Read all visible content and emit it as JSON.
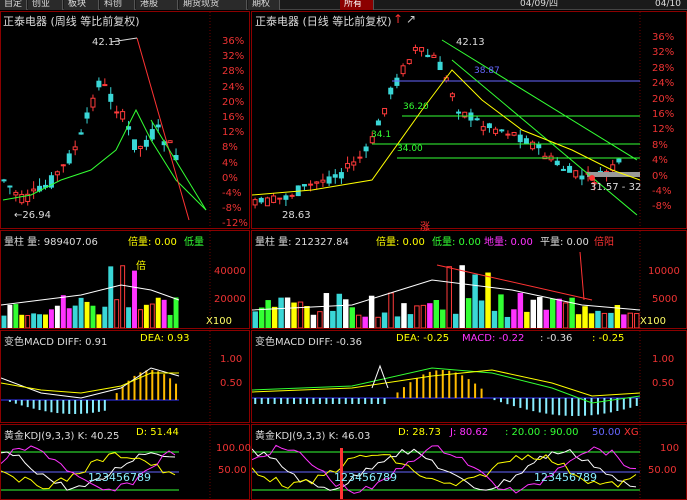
{
  "top_tabs": [
    "自定",
    "创业",
    "板块",
    "科创",
    "港股",
    "期货现货",
    "期权"
  ],
  "active_tab": "所有",
  "dates": [
    "04/09/四",
    "04/10"
  ],
  "weekly": {
    "title": "正泰电器 (周线 等比前复权)",
    "high_label": "42.13",
    "low_label": "←26.94",
    "axis_labels": [
      "36%",
      "32%",
      "28%",
      "24%",
      "20%",
      "16%",
      "12%",
      "8%",
      "4%",
      "0%",
      "-4%",
      "-8%",
      "-12%"
    ],
    "vol_header": "量柱 量: 989407.06",
    "vol_ratio_label": "倍量: 0.00",
    "vol_low_label": "低量",
    "vol_axis": [
      "40000",
      "20000",
      "X100"
    ],
    "macd_header": "变色MACD DIFF: 0.91",
    "macd_dea": "DEA: 0.93",
    "macd_axis": [
      "1.00",
      "0.50"
    ],
    "kdj_header": "黄金KDJ(9,3,3) K: 40.25",
    "kdj_d": "D: 51.44",
    "kdj_axis": [
      "100.00",
      "50.00"
    ],
    "kdj_digits": "123456789",
    "bei_label": "倍"
  },
  "daily": {
    "title": "正泰电器 (日线 等比前复权)",
    "high_label": "42.13",
    "low_label": "28.63",
    "levels": [
      "38.87",
      "36.20",
      "34.1",
      "34.00",
      "31.57 - 32"
    ],
    "axis_labels": [
      "36%",
      "32%",
      "28%",
      "24%",
      "20%",
      "16%",
      "12%",
      "8%",
      "4%",
      "0%",
      "-4%",
      "-8%"
    ],
    "zhang_label": "涨",
    "vol_header": "量柱 量: 212327.84",
    "vol_ratio_label": "倍量: 0.00",
    "vol_low_label": "低量: 0.00",
    "vol_earth_label": "地量: 0.00",
    "vol_flat_label": "平量: 0.00",
    "vol_bei_label": "倍阳",
    "vol_axis": [
      "10000",
      "5000",
      "X100"
    ],
    "macd_header": "变色MACD DIFF: -0.36",
    "macd_dea": "DEA: -0.25",
    "macd_macd": "MACD: -0.22",
    "macd_extra1": ": -0.36",
    "macd_extra2": ": -0.25",
    "macd_axis": [
      "1.00",
      "0.50"
    ],
    "kdj_header": "黄金KDJ(9,3,3) K: 46.03",
    "kdj_d": "D: 28.73",
    "kdj_j": "J: 80.62",
    "kdj_20": ": 20.00 : 90.00",
    "kdj_50": "50.00",
    "kdj_xg": "XG",
    "kdj_axis": [
      "100",
      "50.00"
    ],
    "kdj_digits": "123456789",
    "kdj_digits2": "123456789"
  },
  "colors": {
    "up": "#ff3b3b",
    "down": "#3ad7d7",
    "axis": "#e33",
    "grid": "#8b0000"
  }
}
